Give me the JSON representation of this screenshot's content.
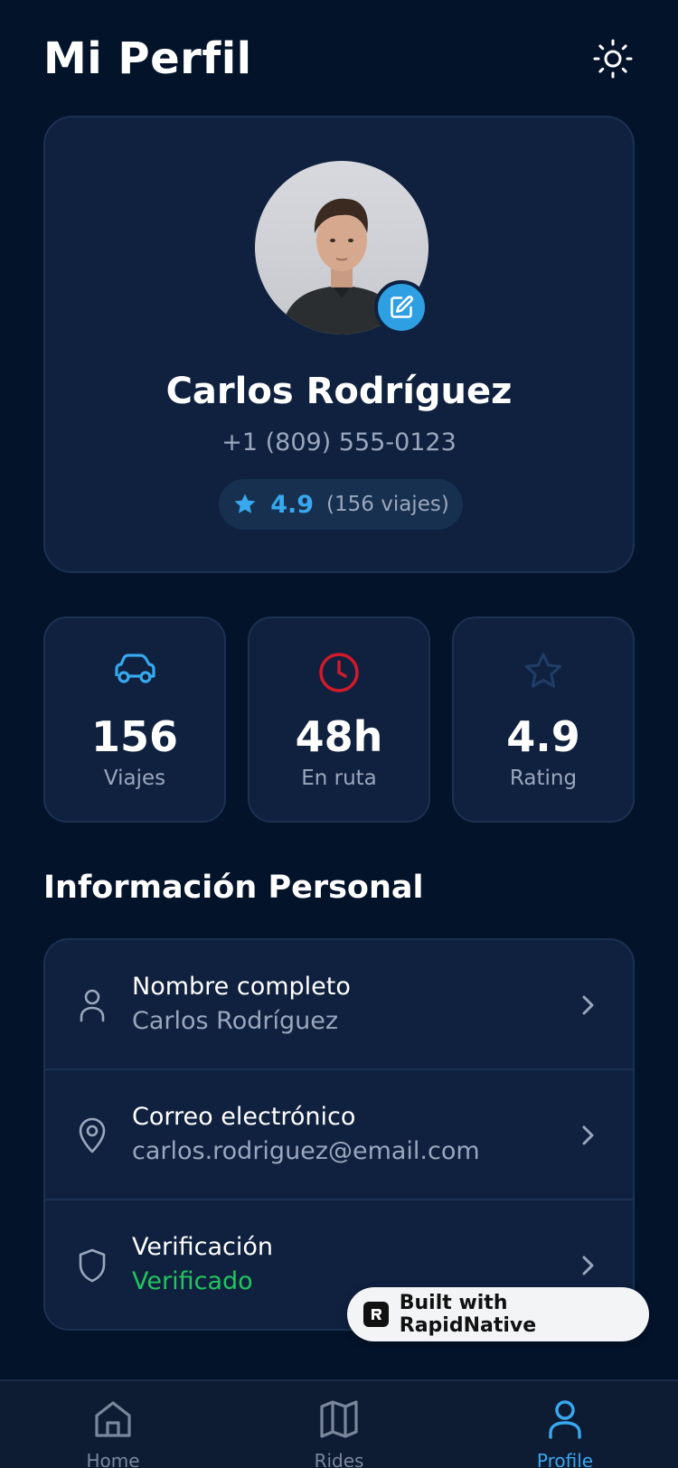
{
  "header": {
    "title": "Mi Perfil",
    "theme_icon": "sun-icon"
  },
  "profile": {
    "name": "Carlos Rodríguez",
    "phone": "+1 (809) 555-0123",
    "rating": "4.9",
    "trips_text": "(156 viajes)",
    "avatar_icon": "avatar",
    "edit_icon": "edit-icon"
  },
  "stats": [
    {
      "icon": "car-icon",
      "value": "156",
      "label": "Viajes",
      "color": "#38a8ef"
    },
    {
      "icon": "clock-icon",
      "value": "48h",
      "label": "En ruta",
      "color": "#d11a2a"
    },
    {
      "icon": "star-icon",
      "value": "4.9",
      "label": "Rating",
      "color": "#1f3d67"
    }
  ],
  "personal": {
    "title": "Información Personal",
    "rows": [
      {
        "icon": "user-icon",
        "label": "Nombre completo",
        "value": "Carlos Rodríguez"
      },
      {
        "icon": "location-pin-icon",
        "label": "Correo electrónico",
        "value": "carlos.rodriguez@email.com"
      },
      {
        "icon": "shield-icon",
        "label": "Verificación",
        "value": "Verificado"
      }
    ]
  },
  "badge": {
    "text": "Built with RapidNative"
  },
  "nav": [
    {
      "label": "Home",
      "icon": "home-icon",
      "active": false
    },
    {
      "label": "Rides",
      "icon": "map-icon",
      "active": false
    },
    {
      "label": "Profile",
      "icon": "profile-icon",
      "active": true
    }
  ],
  "colors": {
    "background": "#03132a",
    "card": "#0f213f",
    "accent": "#38a8ef",
    "success": "#22c55e",
    "muted": "#9aa7bd"
  }
}
